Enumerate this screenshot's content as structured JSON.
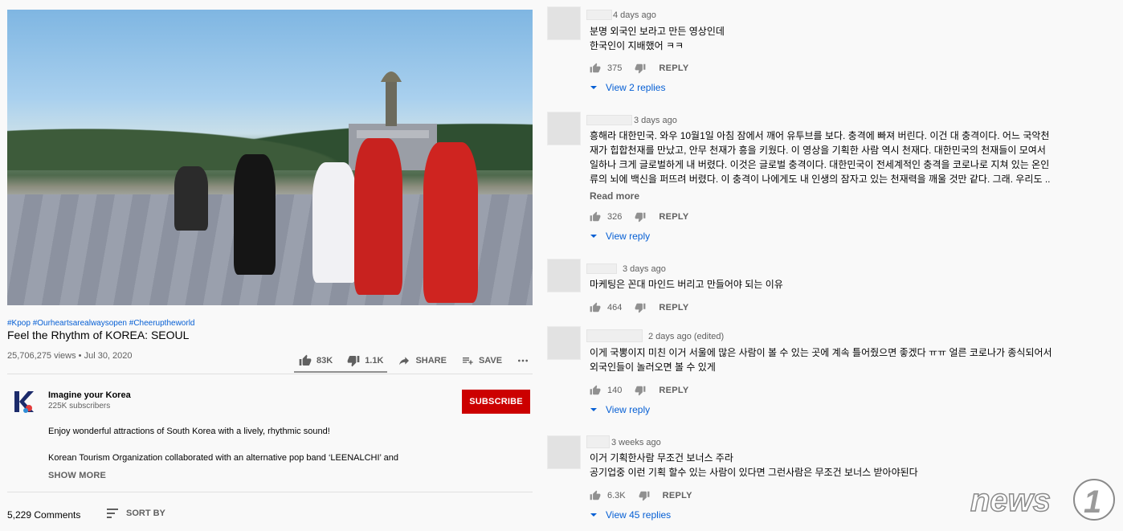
{
  "video": {
    "hashtags": "#Kpop #Ourheartsarealwaysopen #Cheeruptheworld",
    "title": "Feel the Rhythm of KOREA: SEOUL",
    "views": "25,706,275 views • Jul 30, 2020",
    "likes": "83K",
    "dislikes": "1.1K",
    "share_label": "SHARE",
    "save_label": "SAVE"
  },
  "channel": {
    "name": "Imagine your Korea",
    "subscribers": "225K subscribers",
    "subscribe_label": "SUBSCRIBE",
    "description_line1": "Enjoy wonderful attractions of South Korea with a lively, rhythmic sound!",
    "description_line2": "Korean Tourism Organization collaborated with an alternative pop band ‘LEENALCHI’ and",
    "show_more": "SHOW MORE"
  },
  "comments_header": {
    "count": "5,229 Comments",
    "sort_label": "SORT BY"
  },
  "comments": [
    {
      "time": "4 days ago",
      "text": "분명 외국인 보라고 만든 영상인데\n한국인이 지배했어 ㅋㅋ",
      "likes": "375",
      "reply": "REPLY",
      "replies": "View 2 replies"
    },
    {
      "time": "3 days ago",
      "text": "흥해라 대한민국. 와우 10월1일 아침 잠에서 깨어 유투브를 보다. 충격에 빠져 버린다. 이건 대 충격이다. 어느 국악천\n재가 힙합천재를 만났고, 안무 천재가 흥을 키웠다. 이 영상을 기획한 사람 역시 천재다. 대한민국의 천재들이 모여서\n일하나 크게 글로벌하게 내 버렸다. 이것은 글로벌 충격이다. 대한민국이 전세계적인 충격을 코로나로 지쳐 있는 온인\n류의 뇌에 백신을 퍼뜨려 버렸다. 이 충격이 나에게도 내 인생의 잠자고 있는 천재력을 깨울 것만 같다. 그래. 우리도 ..",
      "read_more": "Read more",
      "likes": "326",
      "reply": "REPLY",
      "replies": "View reply"
    },
    {
      "time": "3 days ago",
      "text": "마케팅은 꼰대 마인드 버리고 만들어야 되는 이유",
      "likes": "464",
      "reply": "REPLY"
    },
    {
      "time": "2 days ago (edited)",
      "text": "이게 국뽕이지 미친 이거 서울에 많은 사람이 볼 수 있는 곳에 계속 틀어줬으면 좋겠다 ㅠㅠ 얼른 코로나가 종식되어서\n외국인들이 놀러오면 볼 수 있게",
      "likes": "140",
      "reply": "REPLY",
      "replies": "View reply"
    },
    {
      "time": "3 weeks ago",
      "text": "이거 기획한사람 무조건 보너스 주라\n공기업중 이런 기획 할수 있는 사람이 있다면 그런사람은 무조건 보너스 받아야된다",
      "likes": "6.3K",
      "reply": "REPLY",
      "replies": "View 45 replies"
    }
  ],
  "watermark": "news1",
  "icons": [
    "thumb-up-icon",
    "thumb-down-icon",
    "share-icon",
    "save-icon",
    "more-icon",
    "sort-icon",
    "chevron-down-icon"
  ],
  "colors": {
    "subscribe": "#cc0000",
    "link": "#065fd4",
    "muted": "#606060"
  }
}
